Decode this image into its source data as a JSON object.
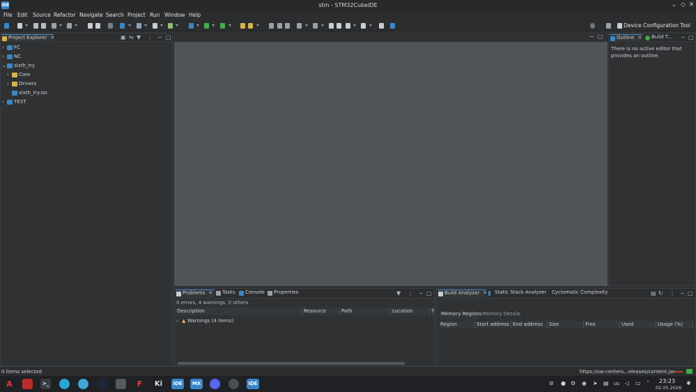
{
  "window": {
    "title": "stm - STM32CubeIDE",
    "logo": "IDE"
  },
  "menu": [
    "File",
    "Edit",
    "Source",
    "Refactor",
    "Navigate",
    "Search",
    "Project",
    "Run",
    "Window",
    "Help"
  ],
  "toolbar": {
    "perspective_label": "Device Configuration Tool"
  },
  "project_explorer": {
    "tab_label": "Project Explorer",
    "items": [
      {
        "label": "FC"
      },
      {
        "label": "NC"
      },
      {
        "label": "sixth_try"
      },
      {
        "label": "Core"
      },
      {
        "label": "Drivers"
      },
      {
        "label": "sixth_try.ioc"
      },
      {
        "label": "TEST"
      }
    ]
  },
  "outline": {
    "tab_label": "Outline",
    "tab2_label": "Build T...",
    "message": "There is no active editor that provides an outline."
  },
  "problems": {
    "tabs": [
      "Problems",
      "Tasks",
      "Console",
      "Properties"
    ],
    "summary": "0 errors, 4 warnings, 0 others",
    "columns": [
      "Description",
      "Resource",
      "Path",
      "Location",
      "Ty"
    ],
    "rows": [
      {
        "label": "Warnings (4 items)"
      }
    ]
  },
  "build_analyzer": {
    "tabs": [
      "Build Analyzer",
      "Static Stack Analyzer",
      "Cyclomatic Complexity"
    ],
    "subtabs": [
      "Memory Regions",
      "Memory Details"
    ],
    "columns": [
      "Region",
      "Start address",
      "End address",
      "Size",
      "Free",
      "Used",
      "Usage (%)"
    ]
  },
  "status": {
    "left": "0 items selected",
    "right": "https://sw-centers...eleases/content.jar"
  },
  "taskbar": {
    "apps": [
      "A",
      "",
      ">_",
      "",
      "",
      "",
      "",
      "F",
      "Ki",
      "IDE",
      "MX",
      "",
      "",
      "IDE"
    ],
    "keyboard": "us",
    "time": "23:23",
    "date": "02.05.2026"
  },
  "colors": {
    "accent": "#4a8fd6",
    "editor_bg": "#505456",
    "panel_bg": "#2f3133"
  }
}
